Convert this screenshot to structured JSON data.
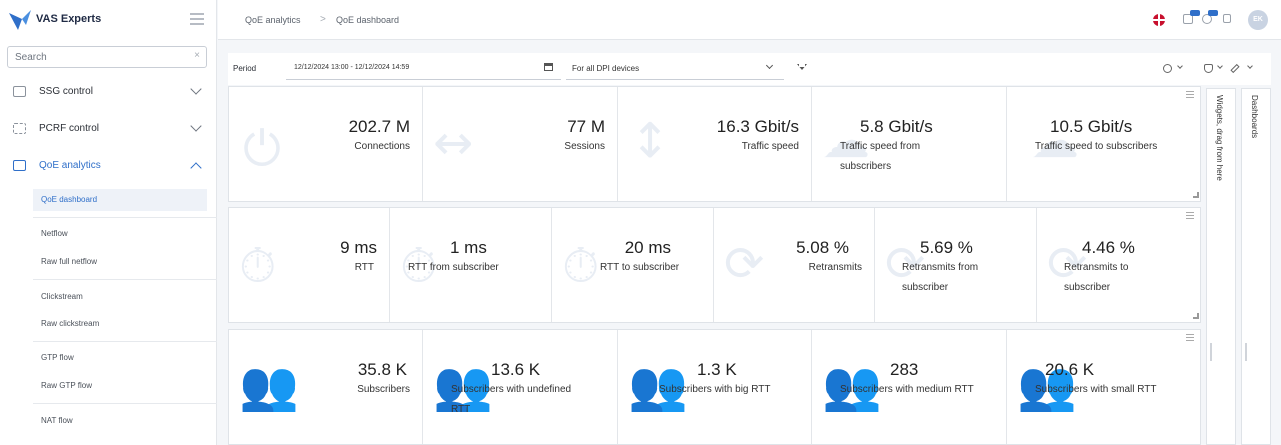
{
  "brand": {
    "name": "VAS Experts",
    "accent": "#2f6fc9"
  },
  "search": {
    "placeholder": "Search",
    "clear": "×"
  },
  "sidebar": {
    "menu": [
      {
        "label": "SSG control",
        "icon": "server-icon",
        "expanded": false
      },
      {
        "label": "PCRF control",
        "icon": "pcrf-icon",
        "expanded": false
      },
      {
        "label": "QoE analytics",
        "icon": "chart-icon",
        "expanded": true
      }
    ],
    "subitems": [
      {
        "label": "QoE dashboard",
        "selected": true
      },
      {
        "label": "Netflow"
      },
      {
        "label": "Raw full netflow"
      },
      {
        "label": "Clickstream"
      },
      {
        "label": "Raw clickstream"
      },
      {
        "label": "GTP flow"
      },
      {
        "label": "Raw GTP flow"
      },
      {
        "label": "NAT flow"
      }
    ]
  },
  "breadcrumb": {
    "items": [
      "QoE analytics",
      "QoE dashboard"
    ],
    "separator": ">"
  },
  "user": {
    "initials": "EK"
  },
  "filters": {
    "period_label": "Period",
    "date_range": "12/12/2024 13:00 - 12/12/2024 14:59",
    "device_select": "For all DPI devices"
  },
  "rows": [
    {
      "cells": [
        {
          "value": "202.7 M",
          "label": "Connections",
          "icon": "plug-icon"
        },
        {
          "value": "77 M",
          "label": "Sessions",
          "icon": "arrows-horizontal-icon"
        },
        {
          "value": "16.3 Gbit/s",
          "label": "Traffic speed",
          "icon": "arrows-vertical-icon"
        },
        {
          "value": "5.8 Gbit/s",
          "label": "Traffic speed from subscribers",
          "label2": "subscribers",
          "label1": "Traffic speed from",
          "icon": "upload-cloud-icon"
        },
        {
          "value": "10.5 Gbit/s",
          "label": "Traffic speed to subscribers",
          "icon": "download-cloud-icon"
        }
      ]
    },
    {
      "cells": [
        {
          "value": "9 ms",
          "label": "RTT",
          "icon": "stopwatch-icon"
        },
        {
          "value": "1 ms",
          "label": "RTT from subscriber",
          "icon": "stopwatch-icon"
        },
        {
          "value": "20 ms",
          "label": "RTT to subscriber",
          "icon": "stopwatch-icon"
        },
        {
          "value": "5.08 %",
          "label": "Retransmits",
          "icon": "repeat-icon"
        },
        {
          "value": "5.69 %",
          "label1": "Retransmits from",
          "label2": "subscriber",
          "icon": "repeat-icon"
        },
        {
          "value": "4.46 %",
          "label1": "Retransmits to",
          "label2": "subscriber",
          "icon": "repeat-icon"
        }
      ]
    },
    {
      "cells": [
        {
          "value": "35.8 K",
          "label": "Subscribers",
          "icon": "users-icon"
        },
        {
          "value": "13.6 K",
          "label1": "Subscribers with undefined",
          "label2": "RTT",
          "icon": "users-icon"
        },
        {
          "value": "1.3 K",
          "label": "Subscribers with big RTT",
          "icon": "users-icon"
        },
        {
          "value": "283",
          "label": "Subscribers with medium RTT",
          "icon": "users-icon"
        },
        {
          "value": "20.6 K",
          "label": "Subscribers with small RTT",
          "icon": "users-icon"
        }
      ]
    }
  ],
  "side_panels": {
    "widgets": "Widgets, drag from here",
    "dashboards": "Dashboards"
  }
}
